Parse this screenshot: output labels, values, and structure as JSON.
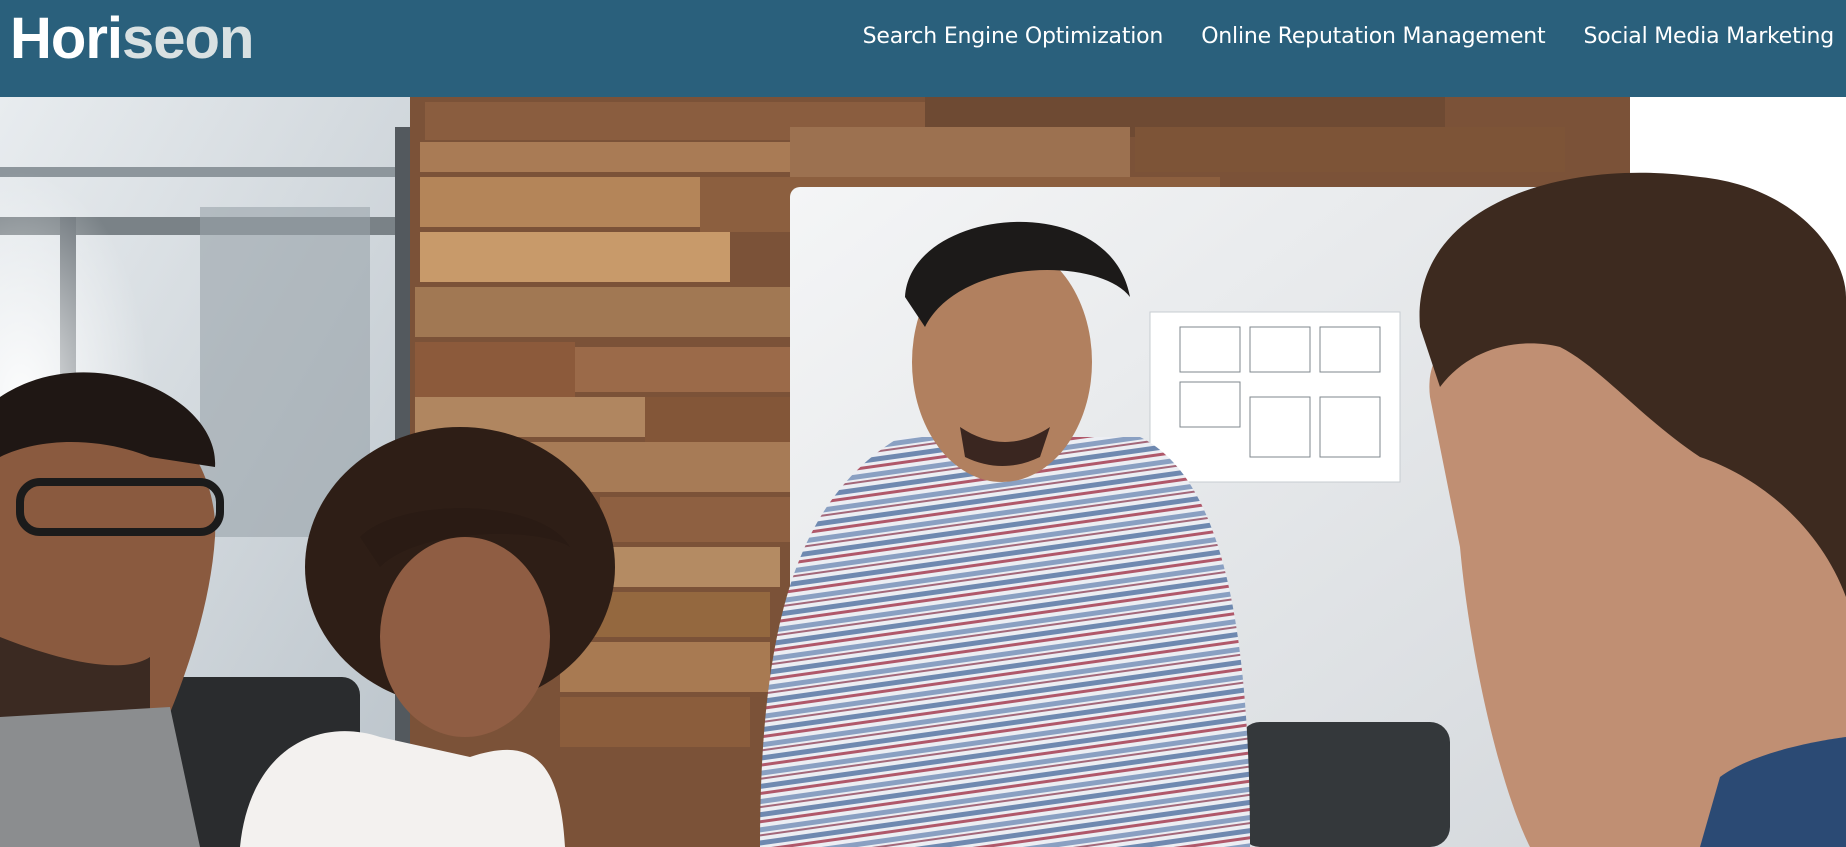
{
  "header": {
    "logo_part1": "Hori",
    "logo_part2": "seon",
    "nav": [
      {
        "label": "Search Engine Optimization"
      },
      {
        "label": "Online Reputation Management"
      },
      {
        "label": "Social Media Marketing"
      }
    ]
  },
  "hero": {
    "image": "team-meeting-photo"
  },
  "colors": {
    "header_bg": "#2a607c",
    "logo_primary": "#ffffff",
    "logo_secondary": "#d9e1e2",
    "nav_text": "#ffffff"
  }
}
